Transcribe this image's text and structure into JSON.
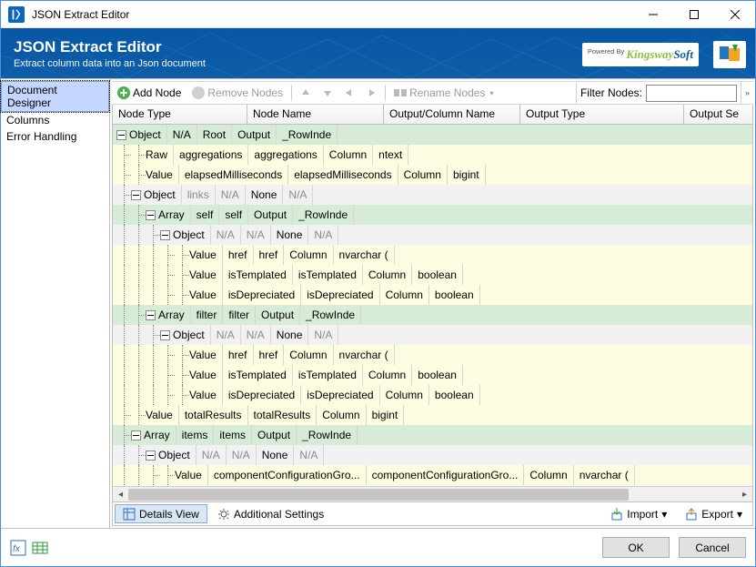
{
  "window": {
    "title": "JSON Extract Editor"
  },
  "header": {
    "title": "JSON Extract Editor",
    "subtitle": "Extract column data into an Json document",
    "poweredBy": "Powered By",
    "brand": {
      "k": "Kingsway",
      "s": "Soft"
    }
  },
  "sidebar": {
    "items": [
      "Document Designer",
      "Columns",
      "Error Handling"
    ],
    "selectedIndex": 0
  },
  "toolbar": {
    "addNode": "Add Node",
    "removeNodes": "Remove Nodes",
    "renameNodes": "Rename Nodes",
    "filterLabel": "Filter Nodes:",
    "filterValue": ""
  },
  "columns": [
    "Node Type",
    "Node Name",
    "Output/Column Name",
    "Output Type",
    "Output Se"
  ],
  "rows": [
    {
      "color": "green",
      "indent": 0,
      "label": "Object",
      "pm": "minus",
      "name": "N/A",
      "col": "Root",
      "otype": "Output",
      "setting": "_RowInde",
      "gray": false
    },
    {
      "color": "yellow",
      "indent": 1,
      "label": "Raw",
      "pm": "none",
      "name": "aggregations",
      "col": "aggregations",
      "otype": "Column",
      "setting": "ntext",
      "gray": false
    },
    {
      "color": "yellow",
      "indent": 1,
      "label": "Value",
      "pm": "none",
      "name": "elapsedMilliseconds",
      "col": "elapsedMilliseconds",
      "otype": "Column",
      "setting": "bigint",
      "gray": false
    },
    {
      "color": "gray",
      "indent": 1,
      "label": "Object",
      "pm": "minus",
      "name": "links",
      "col": "N/A",
      "otype": "None",
      "setting": "N/A",
      "gray": true
    },
    {
      "color": "green",
      "indent": 2,
      "label": "Array",
      "pm": "minus",
      "name": "self",
      "col": "self",
      "otype": "Output",
      "setting": "_RowInde",
      "gray": false
    },
    {
      "color": "gray",
      "indent": 3,
      "label": "Object",
      "pm": "minus",
      "name": "N/A",
      "col": "N/A",
      "otype": "None",
      "setting": "N/A",
      "gray": true
    },
    {
      "color": "yellow",
      "indent": 4,
      "label": "Value",
      "pm": "none",
      "name": "href",
      "col": "href",
      "otype": "Column",
      "setting": "nvarchar (",
      "gray": false
    },
    {
      "color": "yellow",
      "indent": 4,
      "label": "Value",
      "pm": "none",
      "name": "isTemplated",
      "col": "isTemplated",
      "otype": "Column",
      "setting": "boolean",
      "gray": false
    },
    {
      "color": "yellow",
      "indent": 4,
      "label": "Value",
      "pm": "none",
      "name": "isDepreciated",
      "col": "isDepreciated",
      "otype": "Column",
      "setting": "boolean",
      "gray": false
    },
    {
      "color": "green",
      "indent": 2,
      "label": "Array",
      "pm": "minus",
      "name": "filter",
      "col": "filter",
      "otype": "Output",
      "setting": "_RowInde",
      "gray": false
    },
    {
      "color": "gray",
      "indent": 3,
      "label": "Object",
      "pm": "minus",
      "name": "N/A",
      "col": "N/A",
      "otype": "None",
      "setting": "N/A",
      "gray": true
    },
    {
      "color": "yellow",
      "indent": 4,
      "label": "Value",
      "pm": "none",
      "name": "href",
      "col": "href",
      "otype": "Column",
      "setting": "nvarchar (",
      "gray": false
    },
    {
      "color": "yellow",
      "indent": 4,
      "label": "Value",
      "pm": "none",
      "name": "isTemplated",
      "col": "isTemplated",
      "otype": "Column",
      "setting": "boolean",
      "gray": false
    },
    {
      "color": "yellow",
      "indent": 4,
      "label": "Value",
      "pm": "none",
      "name": "isDepreciated",
      "col": "isDepreciated",
      "otype": "Column",
      "setting": "boolean",
      "gray": false
    },
    {
      "color": "yellow",
      "indent": 1,
      "label": "Value",
      "pm": "none",
      "name": "totalResults",
      "col": "totalResults",
      "otype": "Column",
      "setting": "bigint",
      "gray": false
    },
    {
      "color": "green",
      "indent": 1,
      "label": "Array",
      "pm": "minus",
      "name": "items",
      "col": "items",
      "otype": "Output",
      "setting": "_RowInde",
      "gray": false
    },
    {
      "color": "gray",
      "indent": 2,
      "label": "Object",
      "pm": "minus",
      "name": "N/A",
      "col": "N/A",
      "otype": "None",
      "setting": "N/A",
      "gray": true
    },
    {
      "color": "yellow",
      "indent": 3,
      "label": "Value",
      "pm": "none",
      "name": "componentConfigurationGro...",
      "col": "componentConfigurationGro...",
      "otype": "Column",
      "setting": "nvarchar (",
      "gray": false
    }
  ],
  "tabs": {
    "details": "Details View",
    "settings": "Additional Settings",
    "import": "Import",
    "export": "Export"
  },
  "footer": {
    "ok": "OK",
    "cancel": "Cancel"
  }
}
